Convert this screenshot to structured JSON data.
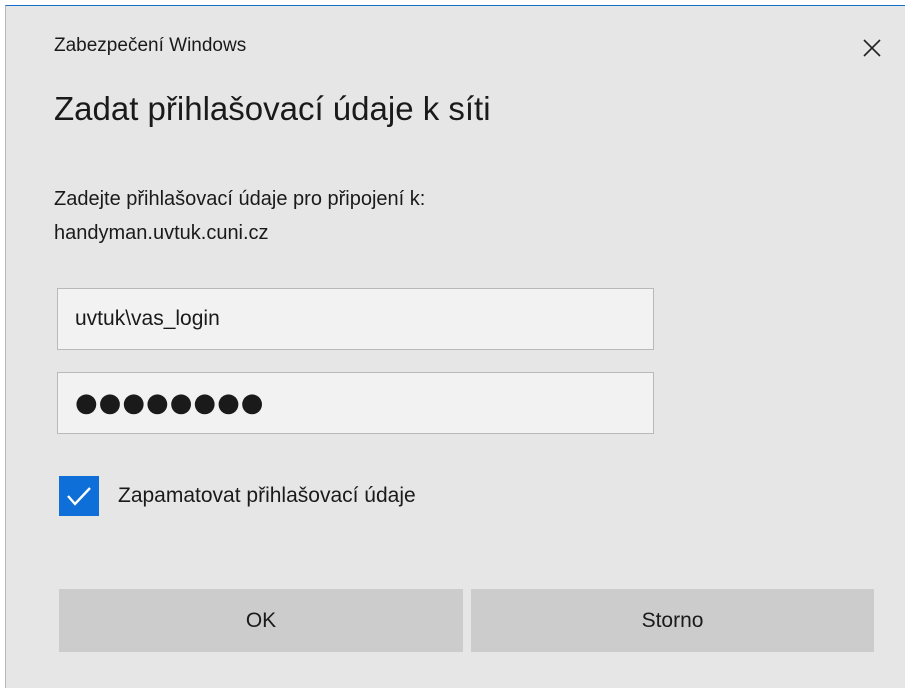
{
  "window": {
    "caption": "Zabezpečení Windows",
    "close_icon": "close-icon"
  },
  "heading": "Zadat přihlašovací údaje k síti",
  "prompt": {
    "line1": "Zadejte přihlašovací údaje pro připojení k:",
    "line2": "handyman.uvtuk.cuni.cz"
  },
  "username": {
    "value": "uvtuk\\vas_login"
  },
  "password": {
    "masked_value": "●●●●●●●●"
  },
  "remember": {
    "label": "Zapamatovat přihlašovací údaje",
    "checked": true
  },
  "buttons": {
    "ok_label": "OK",
    "cancel_label": "Storno"
  },
  "colors": {
    "accent": "#0f6fd8",
    "dialog_bg": "#e6e6e6",
    "button_bg": "#cccccc"
  }
}
